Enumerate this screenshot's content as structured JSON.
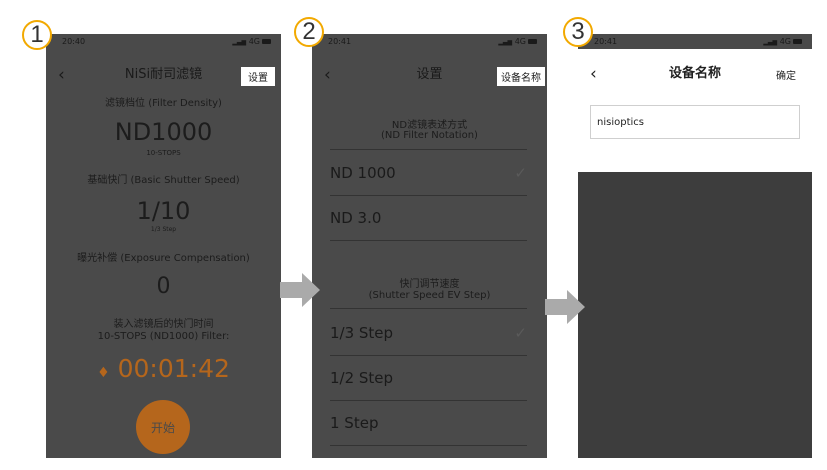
{
  "steps": [
    "1",
    "2",
    "3"
  ],
  "colors": {
    "badge_border": "#f2a900",
    "dim_overlay": "#4a4a4a",
    "timer_orange": "#b5661c",
    "arrow": "#aaaaaa"
  },
  "screen1": {
    "status_time": "20:40",
    "status_signal": "4G",
    "back_icon": "chevron-left-icon",
    "title": "NiSi耐司滤镜",
    "settings_button": "设置",
    "filter_density_label": "滤镜档位 (Filter Density)",
    "filter_density_value": "ND1000",
    "filter_density_stops": "10-STOPS",
    "shutter_label": "基础快门 (Basic Shutter Speed)",
    "shutter_value": "1/10",
    "shutter_step": "1/3 Step",
    "exposure_label": "曝光补偿 (Exposure Compensation)",
    "exposure_value": "0",
    "result_label_1": "装入滤镜后的快门时间",
    "result_label_2": "10-STOPS (ND1000) Filter:",
    "timer_value": "00:01:42",
    "start_button": "开始"
  },
  "screen2": {
    "status_time": "20:41",
    "status_signal": "4G",
    "back_icon": "chevron-left-icon",
    "title": "设置",
    "device_name_button": "设备名称",
    "nd_section_title_1": "ND滤镜表述方式",
    "nd_section_title_2": "(ND Filter Notation)",
    "nd_options": [
      {
        "label": "ND 1000",
        "selected": true
      },
      {
        "label": "ND 3.0",
        "selected": false
      }
    ],
    "shutter_section_title_1": "快门调节速度",
    "shutter_section_title_2": "(Shutter Speed EV Step)",
    "shutter_options": [
      {
        "label": "1/3 Step",
        "selected": true
      },
      {
        "label": "1/2 Step",
        "selected": false
      },
      {
        "label": "1 Step",
        "selected": false
      }
    ],
    "check_icon": "✓"
  },
  "screen3": {
    "status_time": "20:41",
    "status_signal": "4G",
    "back_icon": "chevron-left-icon",
    "title": "设备名称",
    "confirm_button": "确定",
    "device_name_value": "nisioptics"
  }
}
